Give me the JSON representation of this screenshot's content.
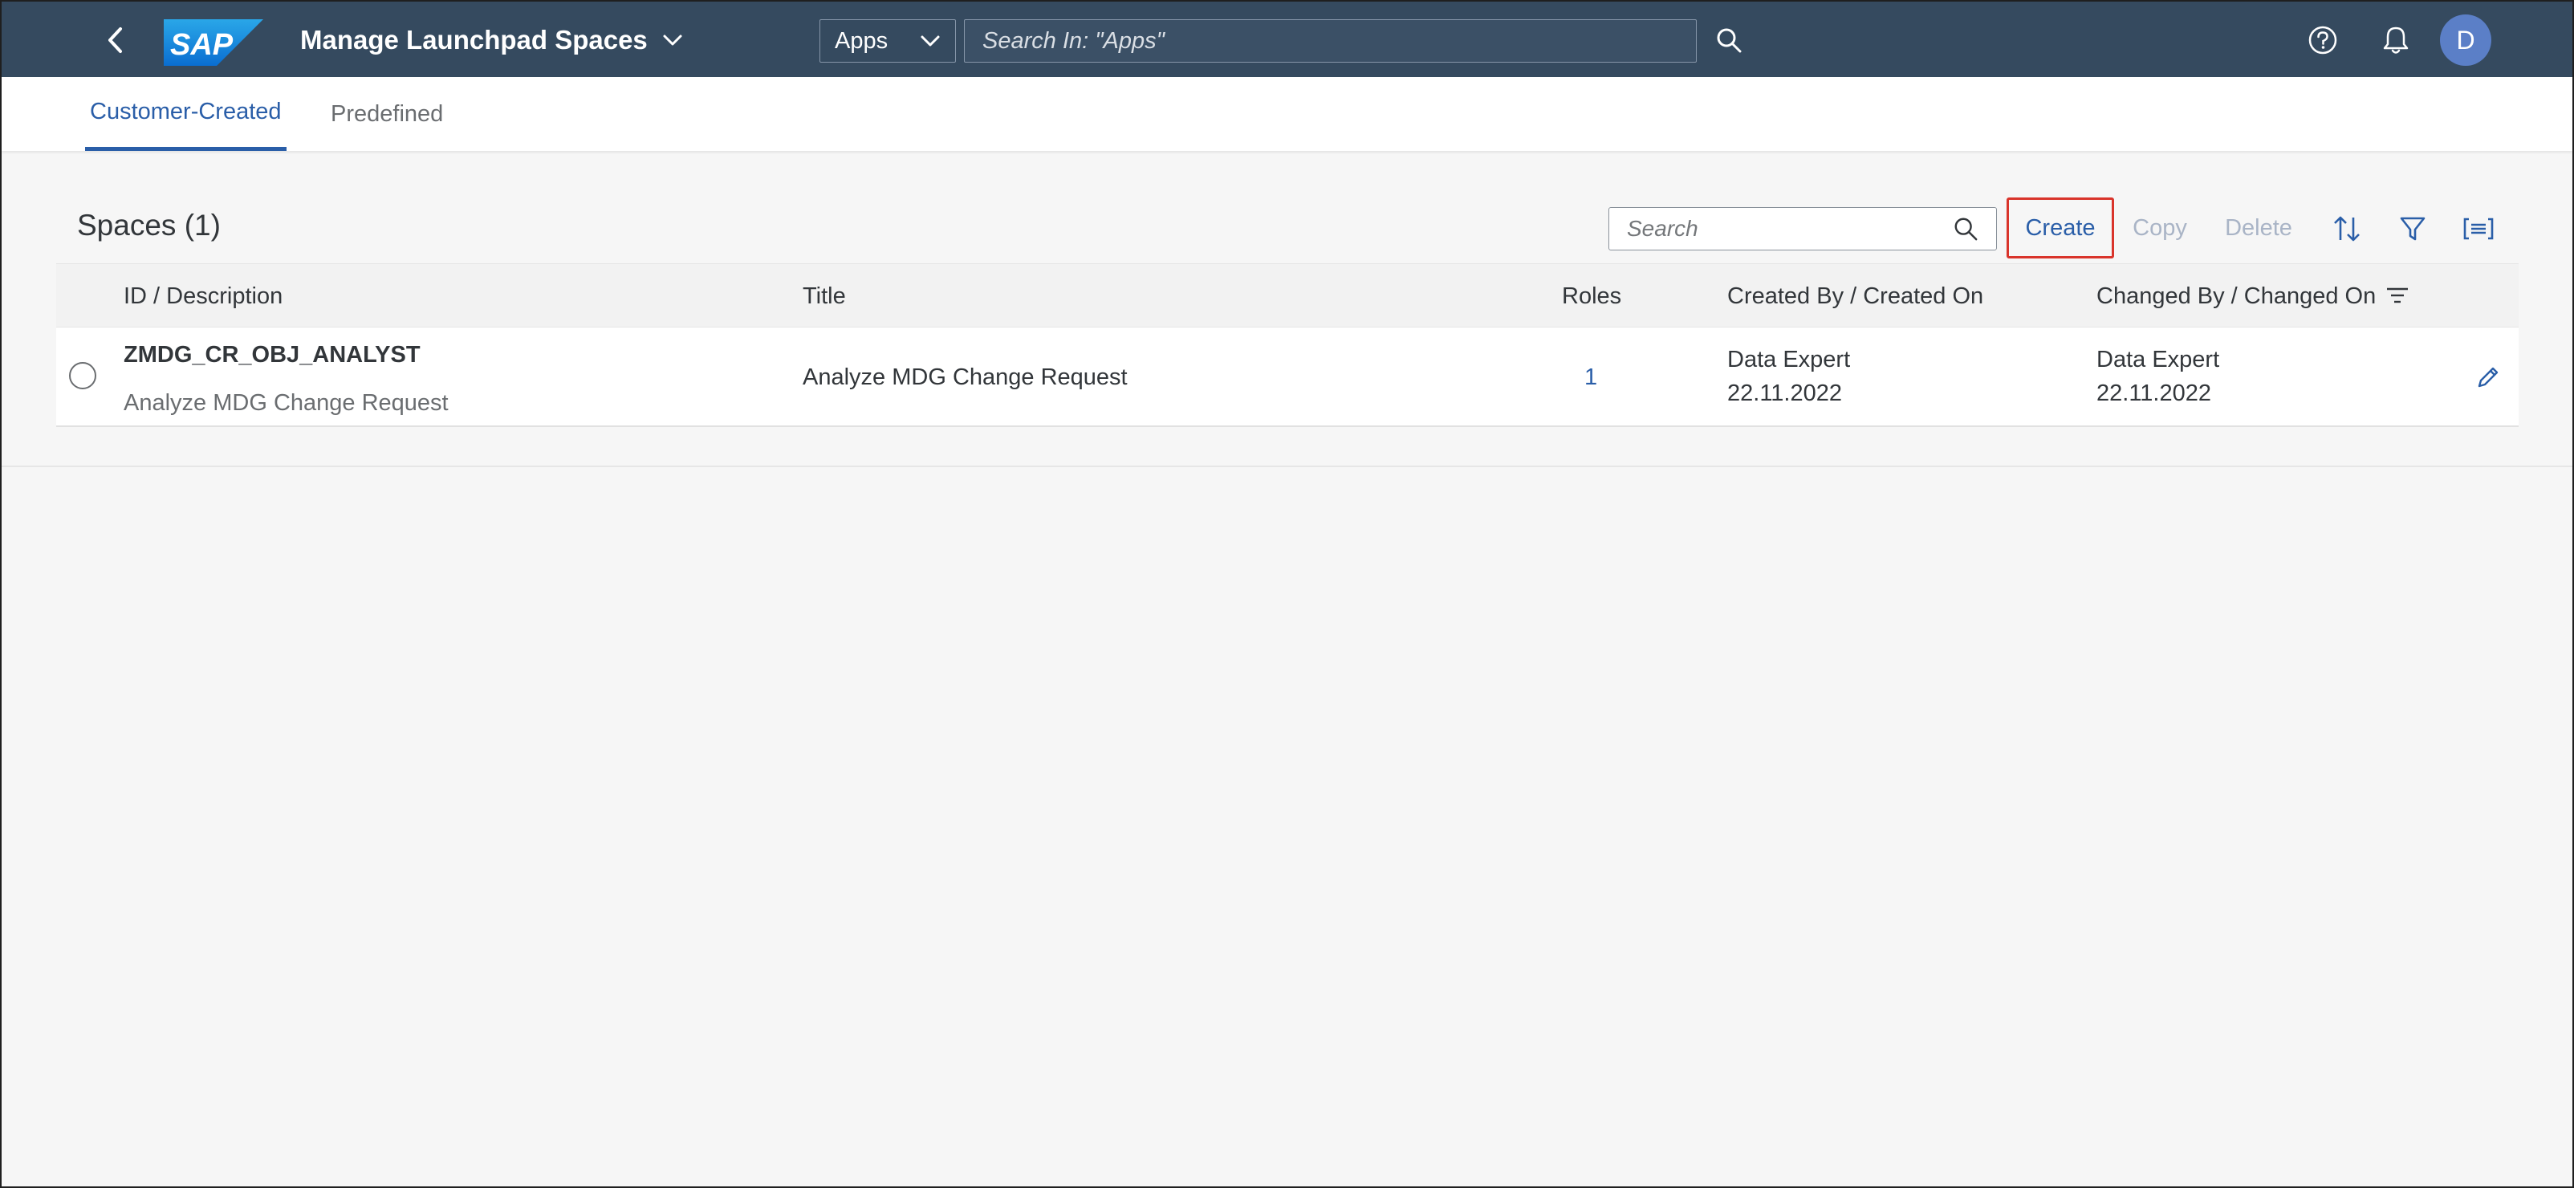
{
  "shell": {
    "app_title": "Manage Launchpad Spaces",
    "search_scope": "Apps",
    "search_placeholder": "Search In: \"Apps\"",
    "avatar_initial": "D",
    "logo_text": "SAP",
    "header_color": "#354a5f"
  },
  "tabs": [
    {
      "label": "Customer-Created",
      "active": true
    },
    {
      "label": "Predefined",
      "active": false
    }
  ],
  "table_toolbar": {
    "title": "Spaces (1)",
    "search_placeholder": "Search",
    "create_label": "Create",
    "copy_label": "Copy",
    "delete_label": "Delete"
  },
  "table": {
    "columns": [
      "ID / Description",
      "Title",
      "Roles",
      "Created By / Created On",
      "Changed By / Changed On"
    ],
    "rows": [
      {
        "id": "ZMDG_CR_OBJ_ANALYST",
        "description": "Analyze MDG Change Request",
        "title": "Analyze MDG Change Request",
        "roles": "1",
        "created_by": "Data Expert",
        "created_on": "22.11.2022",
        "changed_by": "Data Expert",
        "changed_on": "22.11.2022"
      }
    ]
  },
  "colors": {
    "accent": "#2a5ea8",
    "highlight_border": "#d9342b"
  }
}
